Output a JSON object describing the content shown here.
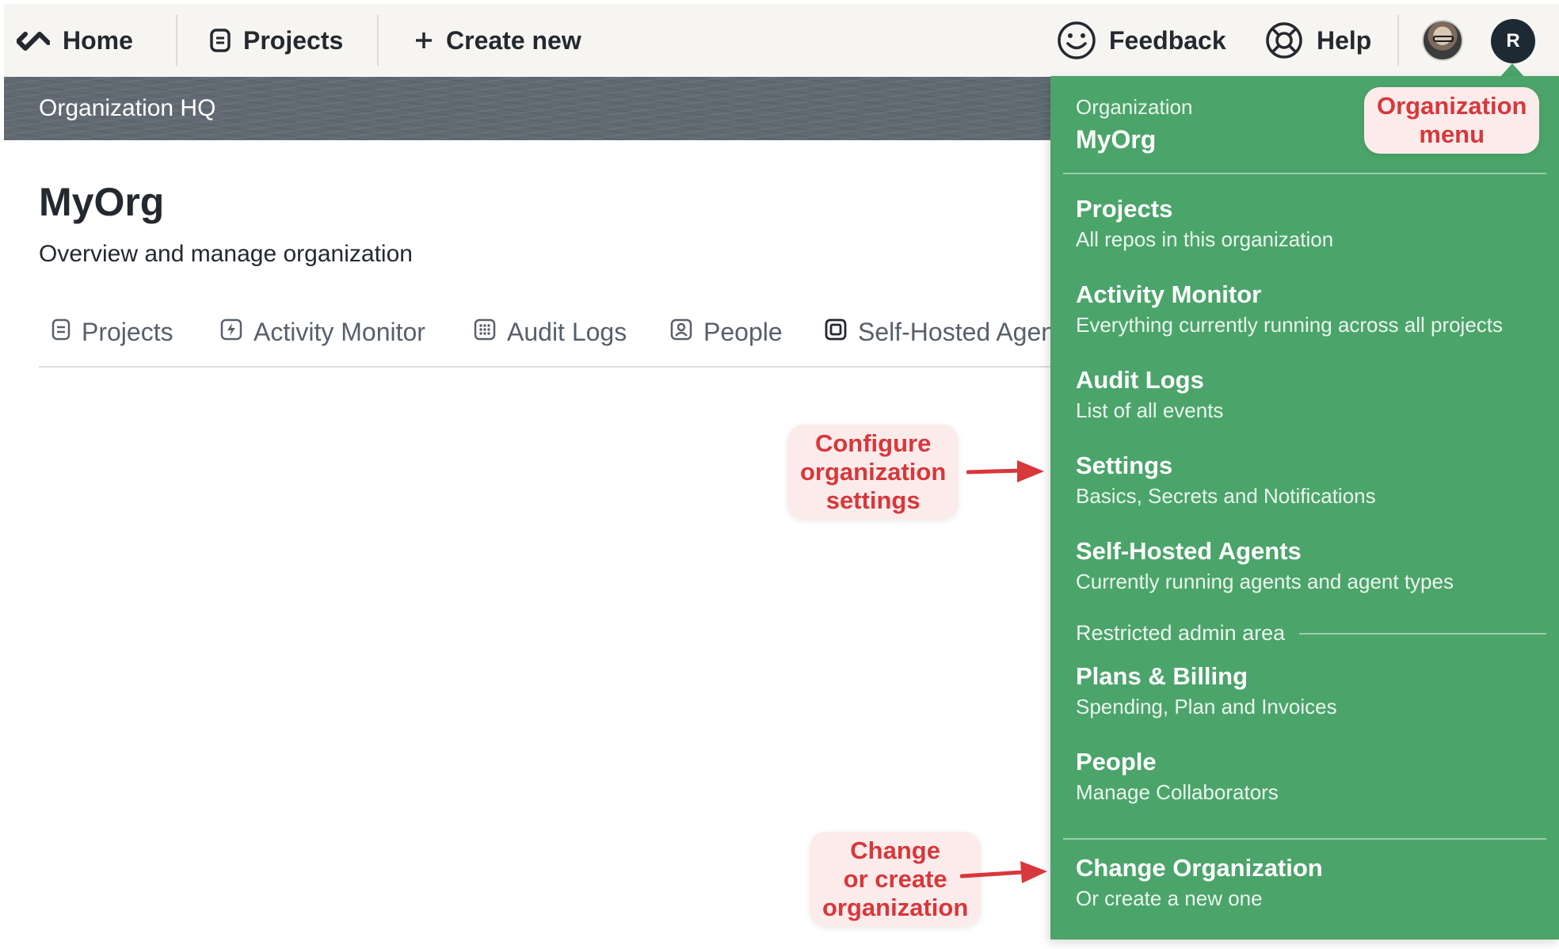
{
  "topbar": {
    "home": "Home",
    "projects": "Projects",
    "create_new": "Create new",
    "feedback": "Feedback",
    "help": "Help",
    "avatar_initial": "R"
  },
  "org_band": {
    "title": "Organization HQ"
  },
  "page": {
    "title": "MyOrg",
    "subtitle": "Overview and manage organization"
  },
  "tabs": [
    {
      "label": "Projects"
    },
    {
      "label": "Activity Monitor"
    },
    {
      "label": "Audit Logs"
    },
    {
      "label": "People"
    },
    {
      "label": "Self-Hosted Agents"
    }
  ],
  "org_menu": {
    "org_label": "Organization",
    "org_name": "MyOrg",
    "items": [
      {
        "title": "Projects",
        "desc": "All repos in this organization"
      },
      {
        "title": "Activity Monitor",
        "desc": "Everything currently running across all projects"
      },
      {
        "title": "Audit Logs",
        "desc": "List of all events"
      },
      {
        "title": "Settings",
        "desc": "Basics, Secrets and Notifications"
      },
      {
        "title": "Self-Hosted Agents",
        "desc": "Currently running agents and agent types"
      }
    ],
    "restricted_label": "Restricted admin area",
    "admin_items": [
      {
        "title": "Plans & Billing",
        "desc": "Spending, Plan and Invoices"
      },
      {
        "title": "People",
        "desc": "Manage Collaborators"
      }
    ],
    "change_org": {
      "title": "Change Organization",
      "desc": "Or create a new one"
    }
  },
  "annotations": {
    "org_menu": [
      "Organization",
      "menu"
    ],
    "configure": [
      "Configure",
      "organization",
      "settings"
    ],
    "change": [
      "Change",
      "or create",
      "organization"
    ]
  },
  "colors": {
    "menu_green": "#4ba46a",
    "annotation_red": "#d8373b",
    "annotation_bg": "#fbeceb",
    "band_gray": "#616a72"
  },
  "icons": {
    "home": "semaphore-logo-icon",
    "projects": "project-doc-icon",
    "create_new": "plus-icon",
    "feedback": "smiley-icon",
    "help": "lifebuoy-icon",
    "tab_activity": "bolt-icon",
    "tab_audit": "grid-icon",
    "tab_people": "person-badge-icon",
    "tab_agents": "chip-icon"
  }
}
